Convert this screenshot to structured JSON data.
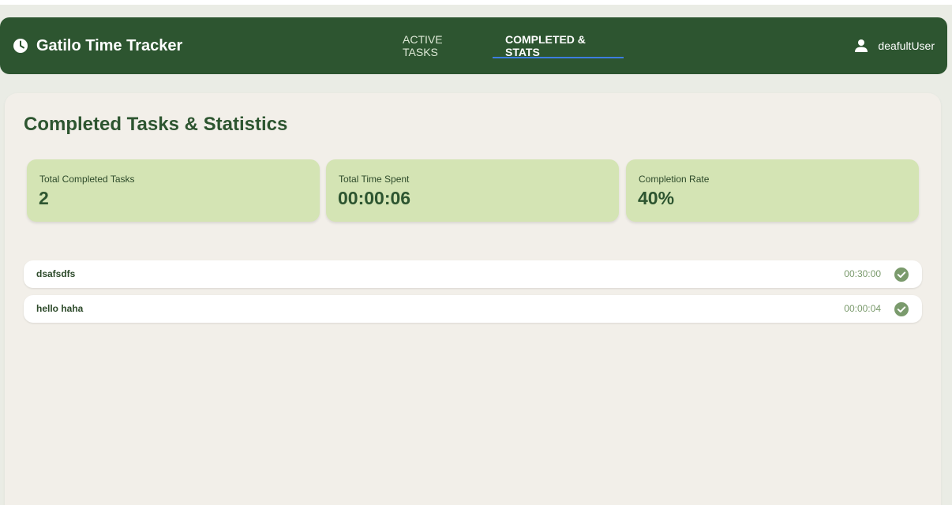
{
  "app": {
    "title": "Gatilo Time Tracker",
    "brand_icon": "clock-icon"
  },
  "nav": {
    "tabs": [
      {
        "label": "ACTIVE TASKS",
        "active": false
      },
      {
        "label": "COMPLETED & STATS",
        "active": true
      }
    ]
  },
  "user": {
    "name": "deafultUser",
    "icon": "user-icon"
  },
  "page": {
    "title": "Completed Tasks & Statistics"
  },
  "stats": [
    {
      "label": "Total Completed Tasks",
      "value": "2"
    },
    {
      "label": "Total Time Spent",
      "value": "00:00:06"
    },
    {
      "label": "Completion Rate",
      "value": "40%"
    }
  ],
  "tasks": [
    {
      "name": "dsafsdfs",
      "time": "00:30:00",
      "status_icon": "check-circle-icon"
    },
    {
      "name": "hello haha",
      "time": "00:00:04",
      "status_icon": "check-circle-icon"
    }
  ],
  "colors": {
    "header_bg": "#2d5530",
    "accent": "#3d7de0",
    "stat_card_bg": "#d4e4b4",
    "page_bg": "#f2efe9",
    "check": "#7a9a6c"
  }
}
